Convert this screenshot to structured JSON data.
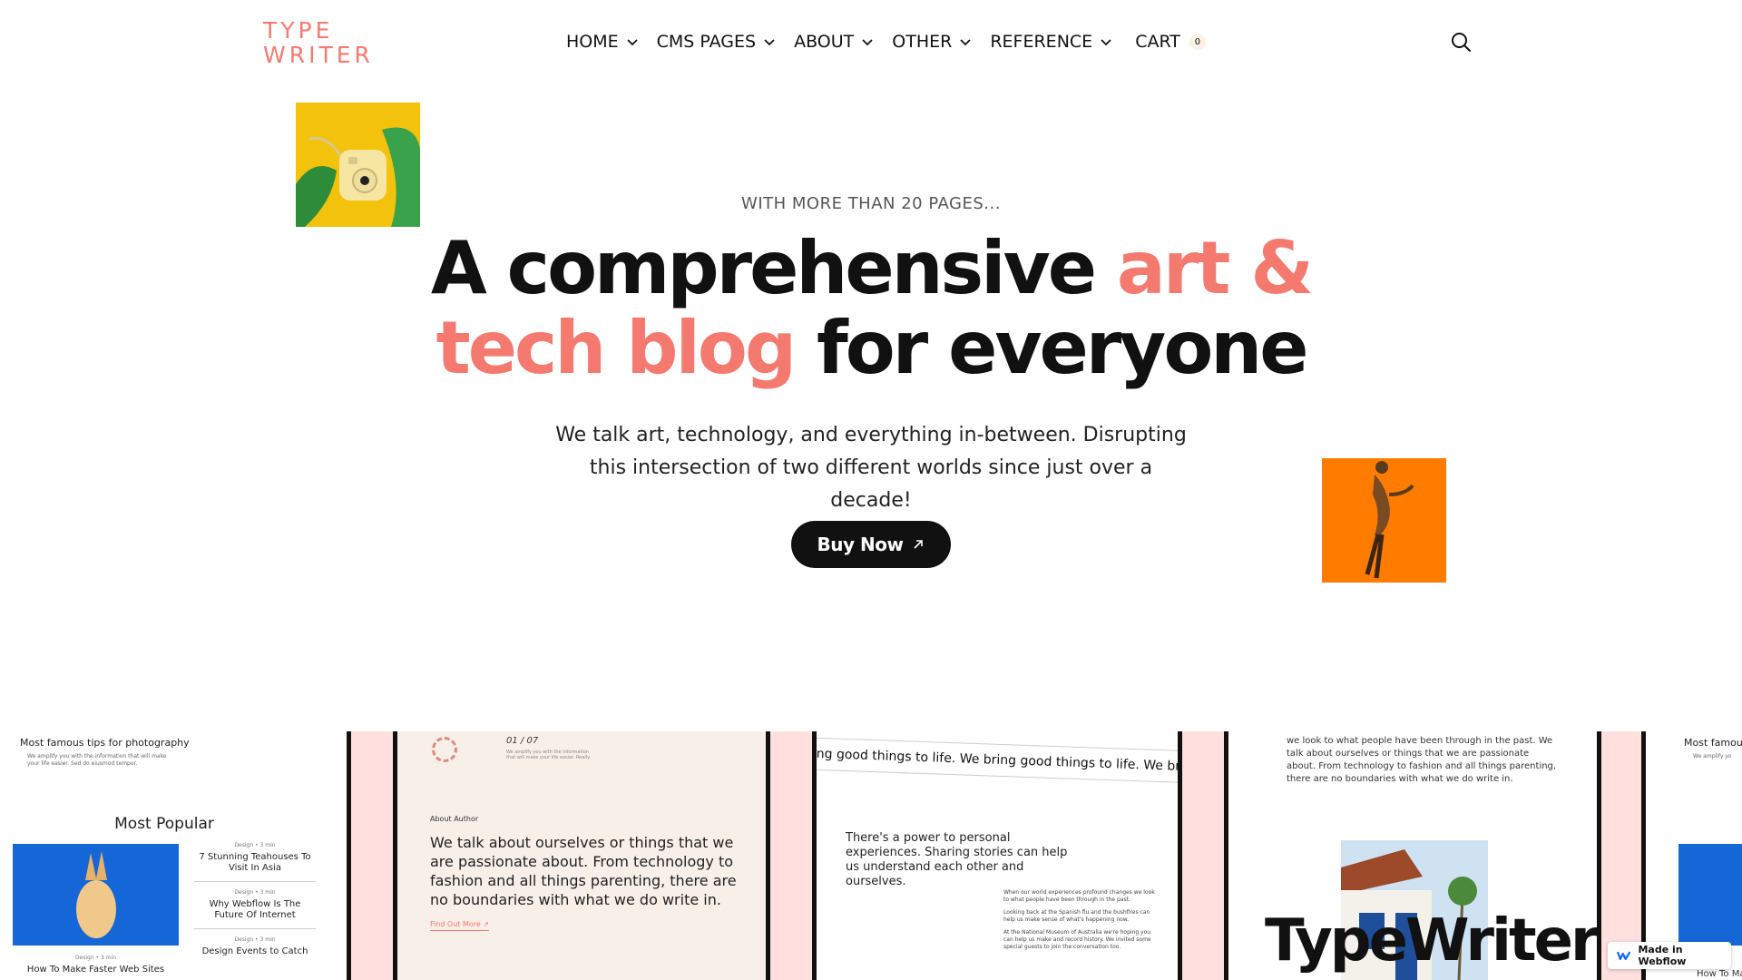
{
  "header": {
    "logo_line1": "TYPE",
    "logo_line2": "WRITER",
    "nav": [
      {
        "label": "HOME"
      },
      {
        "label": "CMS PAGES"
      },
      {
        "label": "ABOUT"
      },
      {
        "label": "OTHER"
      },
      {
        "label": "REFERENCE"
      }
    ],
    "cart_label": "CART",
    "cart_count": "0",
    "search_icon": "search-icon"
  },
  "hero": {
    "eyebrow": "WITH MORE THAN 20 PAGES...",
    "headline_part1": "A comprehensive ",
    "headline_accent1": "art &",
    "headline_accent2": "tech blog",
    "headline_part2": " for everyone",
    "subtitle": "We talk art, technology, and everything in-between. Disrupting this intersection of two different worlds since just over a decade!",
    "cta_label": "Buy Now"
  },
  "colors": {
    "accent": "#f47a6f",
    "dark": "#111111",
    "strip_separator": "#ffe0df"
  },
  "strip": {
    "panel1": {
      "tip_title": "Most famous tips for photography",
      "tip_text": "We amplify you with the information that will make your life easier. Sed do eiusmod tempor.",
      "section_title": "Most Popular",
      "items": [
        {
          "meta": "Design  •  3 min",
          "title": "7 Stunning Teahouses To Visit In Asia"
        },
        {
          "meta": "Design  •  3 min",
          "title": "Why Webflow Is The Future Of Internet"
        },
        {
          "meta": "Design  •  3 min",
          "title": "Design Events to Catch"
        }
      ],
      "feature_meta": "Design  •  3 min",
      "feature_title": "How To Make Faster Web Sites"
    },
    "panel2": {
      "counter": "01 / 07",
      "counter_sub": "We amplify you with the information that will make your life easier. Really.",
      "about_label": "About Author",
      "about_body": "We talk about ourselves or things that we are passionate about. From technology to fashion and all things parenting, there are no boundaries with what we do write in.",
      "find_more": "Find Out More  ↗"
    },
    "panel3": {
      "ticker": "ring good things to life.   We bring good things to life.   We bring",
      "lead": "There's a power to personal experiences. Sharing stories can help us understand each other and ourselves.",
      "small1": "When our world experiences profound changes we look to what people have been through in the past.",
      "small2": "Looking back at the Spanish flu and the bushfires can help us make sense of what's happening now.",
      "small3": "At the National Museum of Australia we're hoping you can help us make and record history. We invited some special guests to join the conversation too."
    },
    "panel4": {
      "text": "we look to what people have been through in the past. We talk about ourselves or things that we are passionate about. From technology to fashion and all things parenting, there are no boundaries with what we do write in.",
      "brand": "TypeWriter"
    },
    "panel5": {
      "tip_title": "Most famous",
      "tip_text": "We amplify yo",
      "caption": "How To Ma"
    }
  },
  "badge": {
    "label": "Made in Webflow"
  }
}
